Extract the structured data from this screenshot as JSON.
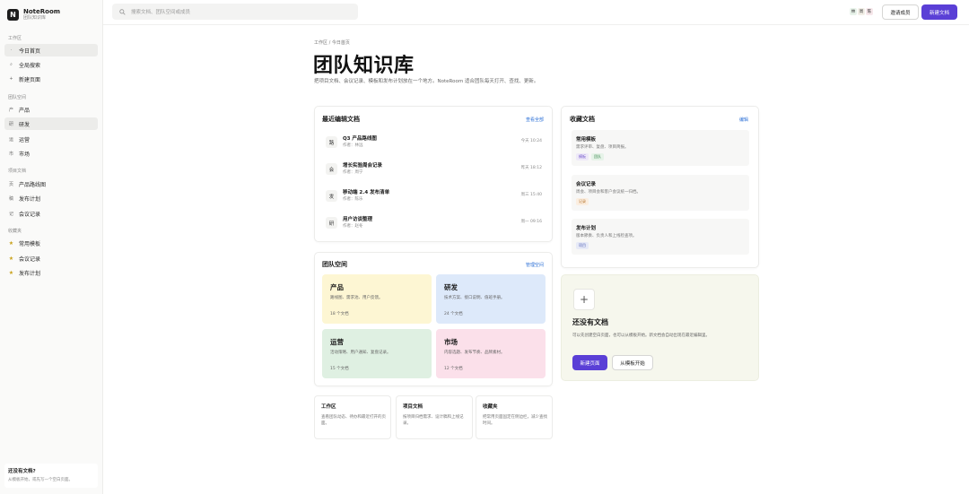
{
  "brand": {
    "logo": "N",
    "name": "NoteRoom",
    "subtitle": "团队知识库"
  },
  "sidebar": {
    "sections": [
      "工作区",
      "团队空间",
      "项目文档",
      "收藏夹"
    ],
    "workspace": [
      {
        "icon": "·",
        "label": "今日首页"
      },
      {
        "icon": "⌕",
        "label": "全局搜索"
      },
      {
        "icon": "+",
        "label": "新建页面"
      }
    ],
    "spaces": [
      {
        "icon": "产",
        "label": "产品"
      },
      {
        "icon": "研",
        "label": "研发"
      },
      {
        "icon": "运",
        "label": "运营"
      },
      {
        "icon": "市",
        "label": "市场"
      }
    ],
    "projects": [
      {
        "icon": "页",
        "label": "产品路线图"
      },
      {
        "icon": "稿",
        "label": "发布计划"
      },
      {
        "icon": "记",
        "label": "会议记录"
      }
    ],
    "favorites": [
      {
        "icon": "★",
        "label": "常用模板"
      },
      {
        "icon": "★",
        "label": "会议记录"
      },
      {
        "icon": "★",
        "label": "发布计划"
      }
    ],
    "footer": {
      "title": "还没有文档?",
      "desc": "从模板开始，或先写一个空白页面。"
    }
  },
  "topbar": {
    "search_placeholder": "搜索文档、团队空间或成员",
    "avatars": [
      {
        "text": "林",
        "color": "#e8f3ea"
      },
      {
        "text": "周",
        "color": "#f1eee6"
      },
      {
        "text": "陈",
        "color": "#f6e7ea"
      }
    ],
    "invite_label": "邀请成员",
    "new_doc_label": "新建文档"
  },
  "header": {
    "breadcrumb": "工作区 / 今日首页",
    "title": "团队知识库",
    "description": "把项目文档、会议记录、模板和发布计划放在一个地方。NoteRoom 适合团队每天打开、查找、更新。"
  },
  "recent": {
    "title": "最近编辑文档",
    "link": "查看全部",
    "docs": [
      {
        "icon": "路",
        "name": "Q3 产品路线图",
        "author": "作者：林远",
        "time": "今天 10:24"
      },
      {
        "icon": "会",
        "name": "增长实验周会记录",
        "author": "作者：周宁",
        "time": "昨天 18:12"
      },
      {
        "icon": "发",
        "name": "移动端 2.4 发布清单",
        "author": "作者：陈乐",
        "time": "周三 15:40"
      },
      {
        "icon": "研",
        "name": "用户访谈整理",
        "author": "作者：赵冬",
        "time": "周一 09:16"
      }
    ]
  },
  "favorites": {
    "title": "收藏文档",
    "link": "编辑",
    "items": [
      {
        "name": "常用模板",
        "desc": "需求评审、复盘、项目简报。",
        "tags": [
          {
            "text": "模板",
            "bg": "#eee9f8",
            "fg": "#6b4fc8"
          },
          {
            "text": "团队",
            "bg": "#e6f3e8",
            "fg": "#3e8a52"
          }
        ]
      },
      {
        "name": "会议记录",
        "desc": "周会、项目会和客户会议统一归档。",
        "tags": [
          {
            "text": "记录",
            "bg": "#fbeee0",
            "fg": "#b5712a"
          }
        ]
      },
      {
        "name": "发布计划",
        "desc": "版本節奏、负责人和上线检查项。",
        "tags": [
          {
            "text": "项目",
            "bg": "#e7eaf7",
            "fg": "#4a5bb4"
          }
        ]
      }
    ]
  },
  "spaces": {
    "title": "团队空间",
    "link": "管理空间",
    "items": [
      {
        "name": "产品",
        "desc": "路线图、需求池、用户反馈。",
        "count": "18 个文档",
        "color": "#fdf6d3"
      },
      {
        "name": "研发",
        "desc": "技术方案、接口说明、值班手册。",
        "count": "24 个文档",
        "color": "#dde9fa"
      },
      {
        "name": "运营",
        "desc": "活动策略、用户通知、复盘记录。",
        "count": "15 个文档",
        "color": "#dff0e2"
      },
      {
        "name": "市场",
        "desc": "内容选题、发布节奏、品牌素材。",
        "count": "12 个文档",
        "color": "#fbe0ea"
      }
    ]
  },
  "empty": {
    "title": "还没有文档",
    "desc": "可以先创建空白页面，也可以从模板开始。新文档会自动出现在最近编辑里。",
    "primary": "新建页面",
    "secondary": "从模板开始"
  },
  "mini_cards": [
    {
      "title": "工作区",
      "desc": "查看团队动态、待办和最近打开的页面。"
    },
    {
      "title": "项目文档",
      "desc": "按项目归档需求、设计稿和上线记录。"
    },
    {
      "title": "收藏夹",
      "desc": "把常用页面固定在侧边栏，减少查找时间。"
    }
  ]
}
